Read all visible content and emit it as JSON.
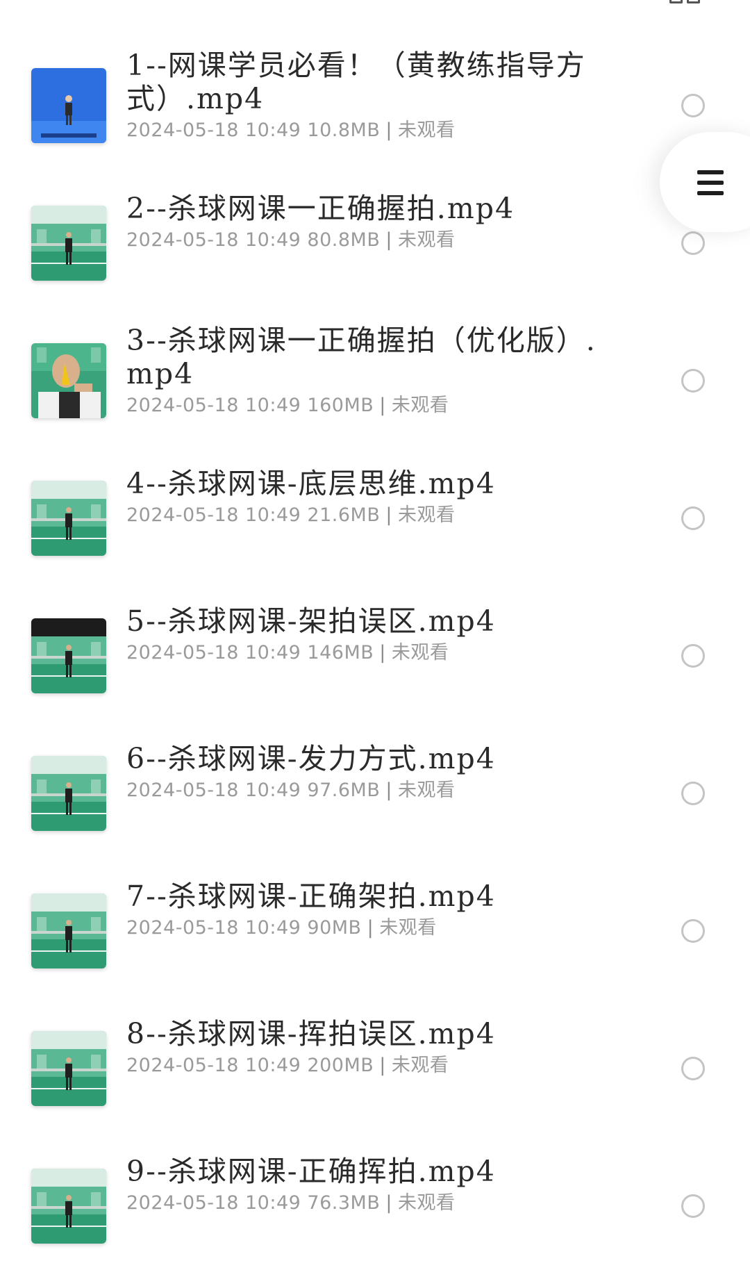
{
  "files": [
    {
      "name": "1--网课学员必看！（黄教练指导方式）.mp4",
      "date": "2024-05-18 10:49",
      "size": "10.8MB",
      "status": "未观看",
      "thumb_style": "blue"
    },
    {
      "name": "2--杀球网课一正确握拍.mp4",
      "date": "2024-05-18 10:49",
      "size": "80.8MB",
      "status": "未观看",
      "thumb_style": "gym"
    },
    {
      "name": "3--杀球网课一正确握拍（优化版）.mp4",
      "date": "2024-05-18 10:49",
      "size": "160MB",
      "status": "未观看",
      "thumb_style": "closeup"
    },
    {
      "name": "4--杀球网课-底层思维.mp4",
      "date": "2024-05-18 10:49",
      "size": "21.6MB",
      "status": "未观看",
      "thumb_style": "gym"
    },
    {
      "name": "5--杀球网课-架拍误区.mp4",
      "date": "2024-05-18 10:49",
      "size": "146MB",
      "status": "未观看",
      "thumb_style": "gym-dark"
    },
    {
      "name": "6--杀球网课-发力方式.mp4",
      "date": "2024-05-18 10:49",
      "size": "97.6MB",
      "status": "未观看",
      "thumb_style": "gym"
    },
    {
      "name": "7--杀球网课-正确架拍.mp4",
      "date": "2024-05-18 10:49",
      "size": "90MB",
      "status": "未观看",
      "thumb_style": "gym"
    },
    {
      "name": "8--杀球网课-挥拍误区.mp4",
      "date": "2024-05-18 10:49",
      "size": "200MB",
      "status": "未观看",
      "thumb_style": "gym"
    },
    {
      "name": "9--杀球网课-正确挥拍.mp4",
      "date": "2024-05-18 10:49",
      "size": "76.3MB",
      "status": "未观看",
      "thumb_style": "gym"
    }
  ],
  "meta_separator": "|",
  "icons": {
    "menu": "hamburger-icon",
    "select": "radio-icon",
    "top": "grid-icon"
  },
  "colors": {
    "text": "#2a2a2a",
    "meta": "#9a9a9a",
    "radio": "#c4c4c4",
    "court": "#2f9b73"
  }
}
